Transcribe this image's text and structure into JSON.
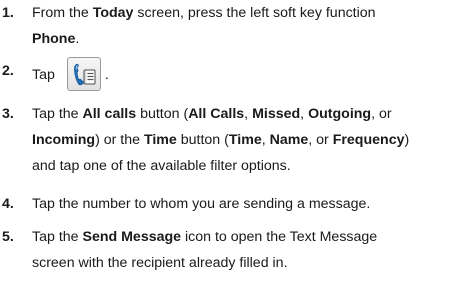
{
  "steps": [
    {
      "num": "1.",
      "line1": [
        "From the ",
        "Today",
        " screen, press the left soft key function"
      ],
      "line2": [
        "Phone",
        "."
      ]
    },
    {
      "num": "2.",
      "before_icon": "Tap",
      "icon": "phone-contacts-icon",
      "after_icon": "."
    },
    {
      "num": "3.",
      "line1": [
        "Tap the ",
        "All calls",
        " button (",
        "All Calls",
        ", ",
        "Missed",
        ", ",
        "Outgoing",
        ", or"
      ],
      "line2": [
        "Incoming",
        ") or the ",
        "Time",
        " button (",
        "Time",
        ", ",
        "Name",
        ", or ",
        "Frequency",
        ")"
      ],
      "line3": "and tap one of the available filter options."
    },
    {
      "num": "4.",
      "line1": "Tap the number to whom you are sending a message."
    },
    {
      "num": "5.",
      "line1": [
        "Tap the ",
        "Send Message",
        " icon to open the Text Message"
      ],
      "line2": "screen with the recipient already filled in."
    }
  ]
}
